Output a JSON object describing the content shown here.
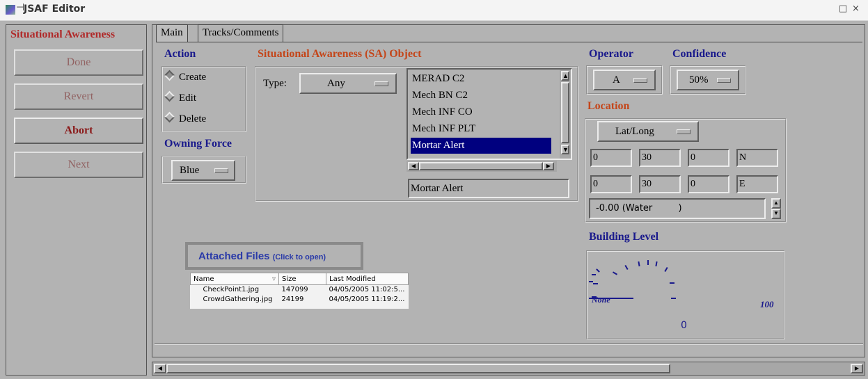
{
  "window": {
    "title": "JSAF Editor",
    "controls": [
      "□",
      "×"
    ]
  },
  "left": {
    "heading": "Situational Awareness",
    "buttons": [
      {
        "label": "Done",
        "enabled": false
      },
      {
        "label": "Revert",
        "enabled": false
      },
      {
        "label": "Abort",
        "enabled": true
      },
      {
        "label": "Next",
        "enabled": false
      }
    ]
  },
  "tabs": [
    {
      "label": "Main",
      "active": true
    },
    {
      "label": "Tracks/Comments",
      "active": false
    }
  ],
  "action": {
    "label": "Action",
    "options": [
      {
        "label": "Create",
        "selected": true
      },
      {
        "label": "Edit",
        "selected": false
      },
      {
        "label": "Delete",
        "selected": false
      }
    ]
  },
  "owning_force": {
    "label": "Owning Force",
    "value": "Blue"
  },
  "sa_object": {
    "label": "Situational Awareness (SA) Object",
    "type_label": "Type:",
    "type_value": "Any",
    "list": [
      "MERAD C2",
      "Mech BN C2",
      "Mech INF CO",
      "Mech INF PLT",
      "Mortar Alert"
    ],
    "selected": "Mortar Alert",
    "name_value": "Mortar Alert"
  },
  "operator": {
    "label": "Operator",
    "value": "A"
  },
  "confidence": {
    "label": "Confidence",
    "value": "50%"
  },
  "location": {
    "label": "Location",
    "format": "Lat/Long",
    "lat": [
      "0",
      "30",
      "0",
      "N"
    ],
    "lon": [
      "0",
      "30",
      "0",
      "E"
    ],
    "elevation": "-0.00 (Water         )"
  },
  "building_level": {
    "label": "Building Level",
    "min_label": "None",
    "max_label": "100",
    "value": "0"
  },
  "attached_files": {
    "title": "Attached Files",
    "hint": "(Click to open)",
    "columns": [
      "Name",
      "Size",
      "Last Modified"
    ],
    "rows": [
      [
        "CheckPoint1.jpg",
        "147099",
        "04/05/2005 11:02:5..."
      ],
      [
        "CrowdGathering.jpg",
        "24199",
        "04/05/2005 11:19:2..."
      ]
    ]
  },
  "colors": {
    "panel": "#b3b3b3",
    "label_blue": "#1a1a8c",
    "label_orange": "#c4461a",
    "selection": "#00007f"
  }
}
